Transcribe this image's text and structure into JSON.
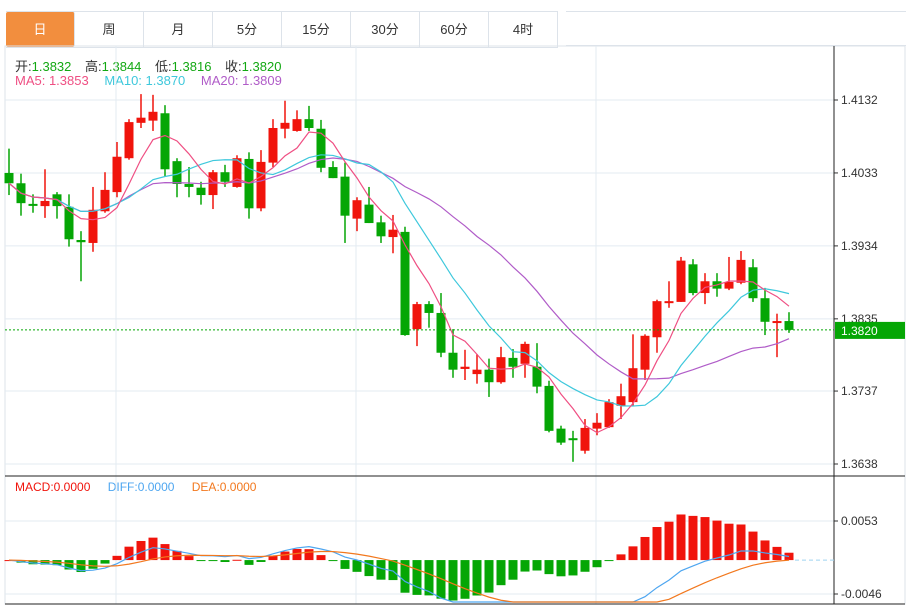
{
  "tabs": [
    {
      "label": "日",
      "active": true
    },
    {
      "label": "周",
      "active": false
    },
    {
      "label": "月",
      "active": false
    },
    {
      "label": "5分",
      "active": false
    },
    {
      "label": "15分",
      "active": false
    },
    {
      "label": "30分",
      "active": false
    },
    {
      "label": "60分",
      "active": false
    },
    {
      "label": "4时",
      "active": false
    }
  ],
  "ohlc_info": {
    "open_label": "开:",
    "open": "1.3832",
    "high_label": "高:",
    "high": "1.3844",
    "low_label": "低:",
    "low": "1.3816",
    "close_label": "收:",
    "close": "1.3820"
  },
  "ma_info": {
    "ma5": "MA5: 1.3853",
    "ma10": "MA10: 1.3870",
    "ma20": "MA20: 1.3809"
  },
  "macd_info": {
    "macd": "MACD:0.0000",
    "diff": "DIFF:0.0000",
    "dea": "DEA:0.0000"
  },
  "colors": {
    "up": "#f0140c",
    "down": "#05a605",
    "ma5": "#ef4f83",
    "ma10": "#3ec8dc",
    "ma20": "#b05cc8",
    "diff": "#4ea6f0",
    "dea": "#f2781e",
    "active_tab": "#f28e3e",
    "price_tag": "#05a605"
  },
  "chart_data": {
    "type": "candlestick",
    "price_axis": {
      "ticks": [
        "1.4132",
        "1.4033",
        "1.3934",
        "1.3835",
        "1.3737",
        "1.3638"
      ],
      "range": [
        1.3638,
        1.4132
      ]
    },
    "current_price": "1.3820",
    "macd_axis": {
      "ticks": [
        "0.0053",
        "-0.0046"
      ],
      "range": [
        -0.0046,
        0.0053
      ]
    },
    "ohlc": [
      [
        1.4033,
        1.4066,
        1.4003,
        1.4019
      ],
      [
        1.4019,
        1.4032,
        1.3975,
        1.3992
      ],
      [
        1.3991,
        1.4004,
        1.3979,
        1.399
      ],
      [
        1.3988,
        1.4038,
        1.3972,
        1.3995
      ],
      [
        1.4004,
        1.4007,
        1.3971,
        1.3988
      ],
      [
        1.3987,
        1.4004,
        1.3933,
        1.3943
      ],
      [
        1.3942,
        1.3954,
        1.3886,
        1.3939
      ],
      [
        1.3938,
        1.4014,
        1.3926,
        1.3983
      ],
      [
        1.3981,
        1.4034,
        1.3979,
        1.401
      ],
      [
        1.4007,
        1.4075,
        1.4,
        1.4055
      ],
      [
        1.4053,
        1.4106,
        1.4051,
        1.4102
      ],
      [
        1.4101,
        1.414,
        1.4094,
        1.4108
      ],
      [
        1.4104,
        1.4139,
        1.409,
        1.4116
      ],
      [
        1.4114,
        1.4125,
        1.4028,
        1.4038
      ],
      [
        1.4049,
        1.4053,
        1.4,
        1.4018
      ],
      [
        1.4018,
        1.4041,
        1.4,
        1.4014
      ],
      [
        1.4013,
        1.4021,
        1.399,
        1.4003
      ],
      [
        1.4003,
        1.4037,
        1.3984,
        1.4034
      ],
      [
        1.4034,
        1.4044,
        1.4014,
        1.4021
      ],
      [
        1.4014,
        1.4057,
        1.4013,
        1.4053
      ],
      [
        1.4052,
        1.4061,
        1.3971,
        1.3985
      ],
      [
        1.3985,
        1.4064,
        1.3981,
        1.4048
      ],
      [
        1.4047,
        1.4106,
        1.4041,
        1.4094
      ],
      [
        1.4093,
        1.4131,
        1.408,
        1.4101
      ],
      [
        1.409,
        1.4118,
        1.4089,
        1.4106
      ],
      [
        1.4106,
        1.4124,
        1.409,
        1.4094
      ],
      [
        1.4093,
        1.4105,
        1.4034,
        1.404
      ],
      [
        1.4041,
        1.4049,
        1.4026,
        1.4026
      ],
      [
        1.4028,
        1.4047,
        1.3938,
        1.3975
      ],
      [
        1.3971,
        1.4,
        1.3954,
        1.3996
      ],
      [
        1.399,
        1.4014,
        1.3965,
        1.3965
      ],
      [
        1.3966,
        1.3975,
        1.3938,
        1.3947
      ],
      [
        1.3946,
        1.3976,
        1.3924,
        1.3956
      ],
      [
        1.3953,
        1.396,
        1.3812,
        1.3813
      ],
      [
        1.3821,
        1.3858,
        1.3798,
        1.3855
      ],
      [
        1.3855,
        1.3859,
        1.3823,
        1.3843
      ],
      [
        1.3843,
        1.387,
        1.3783,
        1.3789
      ],
      [
        1.3789,
        1.3821,
        1.3755,
        1.3766
      ],
      [
        1.3767,
        1.3793,
        1.3752,
        1.377
      ],
      [
        1.376,
        1.3787,
        1.3747,
        1.3766
      ],
      [
        1.3766,
        1.3781,
        1.3729,
        1.3749
      ],
      [
        1.3749,
        1.3797,
        1.3747,
        1.3783
      ],
      [
        1.3782,
        1.3794,
        1.3755,
        1.377
      ],
      [
        1.3774,
        1.3804,
        1.3755,
        1.3801
      ],
      [
        1.377,
        1.3802,
        1.3734,
        1.3743
      ],
      [
        1.3744,
        1.3751,
        1.3681,
        1.3683
      ],
      [
        1.3686,
        1.369,
        1.3664,
        1.3667
      ],
      [
        1.3673,
        1.3683,
        1.3641,
        1.3672
      ],
      [
        1.3656,
        1.3699,
        1.3652,
        1.3687
      ],
      [
        1.3686,
        1.3707,
        1.3677,
        1.3694
      ],
      [
        1.3688,
        1.3726,
        1.3687,
        1.3722
      ],
      [
        1.3717,
        1.3747,
        1.3699,
        1.373
      ],
      [
        1.3722,
        1.3814,
        1.3717,
        1.3768
      ],
      [
        1.3766,
        1.3814,
        1.3752,
        1.3812
      ],
      [
        1.381,
        1.3861,
        1.3789,
        1.3859
      ],
      [
        1.3858,
        1.3886,
        1.385,
        1.3859
      ],
      [
        1.3858,
        1.3919,
        1.3858,
        1.3914
      ],
      [
        1.3909,
        1.3916,
        1.3867,
        1.387
      ],
      [
        1.387,
        1.3897,
        1.3855,
        1.3886
      ],
      [
        1.3886,
        1.3897,
        1.3865,
        1.3876
      ],
      [
        1.3876,
        1.3919,
        1.3874,
        1.3885
      ],
      [
        1.3884,
        1.3927,
        1.3882,
        1.3915
      ],
      [
        1.3905,
        1.3916,
        1.3858,
        1.3863
      ],
      [
        1.3863,
        1.3877,
        1.3813,
        1.3831
      ],
      [
        1.3831,
        1.3842,
        1.3783,
        1.3832
      ],
      [
        1.3832,
        1.3844,
        1.3816,
        1.382
      ]
    ]
  }
}
